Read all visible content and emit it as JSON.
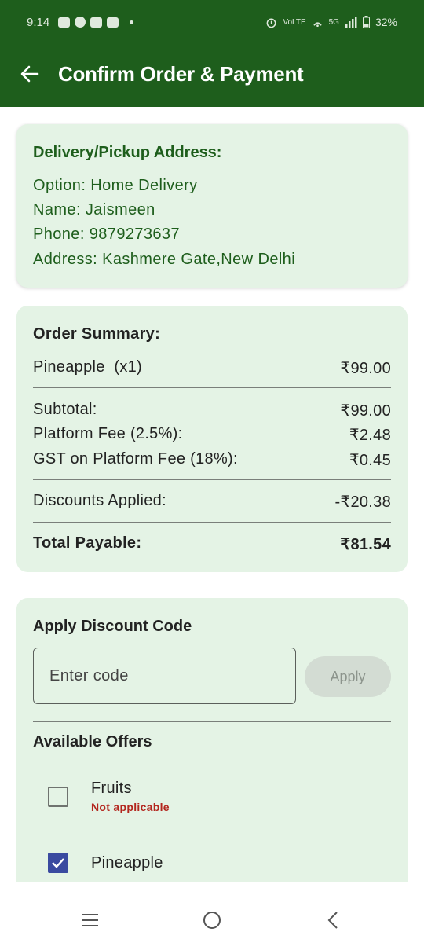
{
  "status_bar": {
    "time": "9:14",
    "network": "5G",
    "volte": "VoLTE",
    "battery": "32%",
    "icons_left": [
      "youtube-icon",
      "messenger-icon",
      "linkedin-icon",
      "gmail-icon",
      "notification-dot"
    ],
    "icons_right": [
      "alarm-icon",
      "volte-icon",
      "hotspot-icon",
      "signal-icon",
      "battery-icon"
    ]
  },
  "header": {
    "back_icon": "arrow-left-icon",
    "title": "Confirm Order & Payment"
  },
  "address": {
    "title": "Delivery/Pickup Address:",
    "option": "Option: Home Delivery",
    "name": "Name: Jaismeen",
    "phone": "Phone: 9879273637",
    "address": "Address: Kashmere Gate,New Delhi"
  },
  "summary": {
    "title": "Order Summary:",
    "item_label": "Pineapple  (x1)",
    "item_price": "₹99.00",
    "subtotal_label": "Subtotal:",
    "subtotal_value": "₹99.00",
    "platform_fee_label": "Platform Fee (2.5%):",
    "platform_fee_value": "₹2.48",
    "gst_label": "GST on Platform Fee (18%):",
    "gst_value": "₹0.45",
    "discount_label": "Discounts Applied:",
    "discount_value": "-₹20.38",
    "total_label": "Total Payable:",
    "total_value": "₹81.54"
  },
  "discount": {
    "title": "Apply Discount Code",
    "placeholder": "Enter code",
    "apply_label": "Apply",
    "offers_title": "Available Offers",
    "offers": [
      {
        "name": "Fruits",
        "note": "Not applicable",
        "checked": false
      },
      {
        "name": "Pineapple",
        "note": "",
        "checked": true
      }
    ]
  },
  "colors": {
    "primary": "#1e5e1c",
    "card_bg": "#e4f3e5",
    "checkbox_checked": "#3a4aa0",
    "error": "#b3261e"
  },
  "nav_bar": {
    "icons": [
      "recent-apps-icon",
      "home-icon",
      "back-icon"
    ]
  }
}
